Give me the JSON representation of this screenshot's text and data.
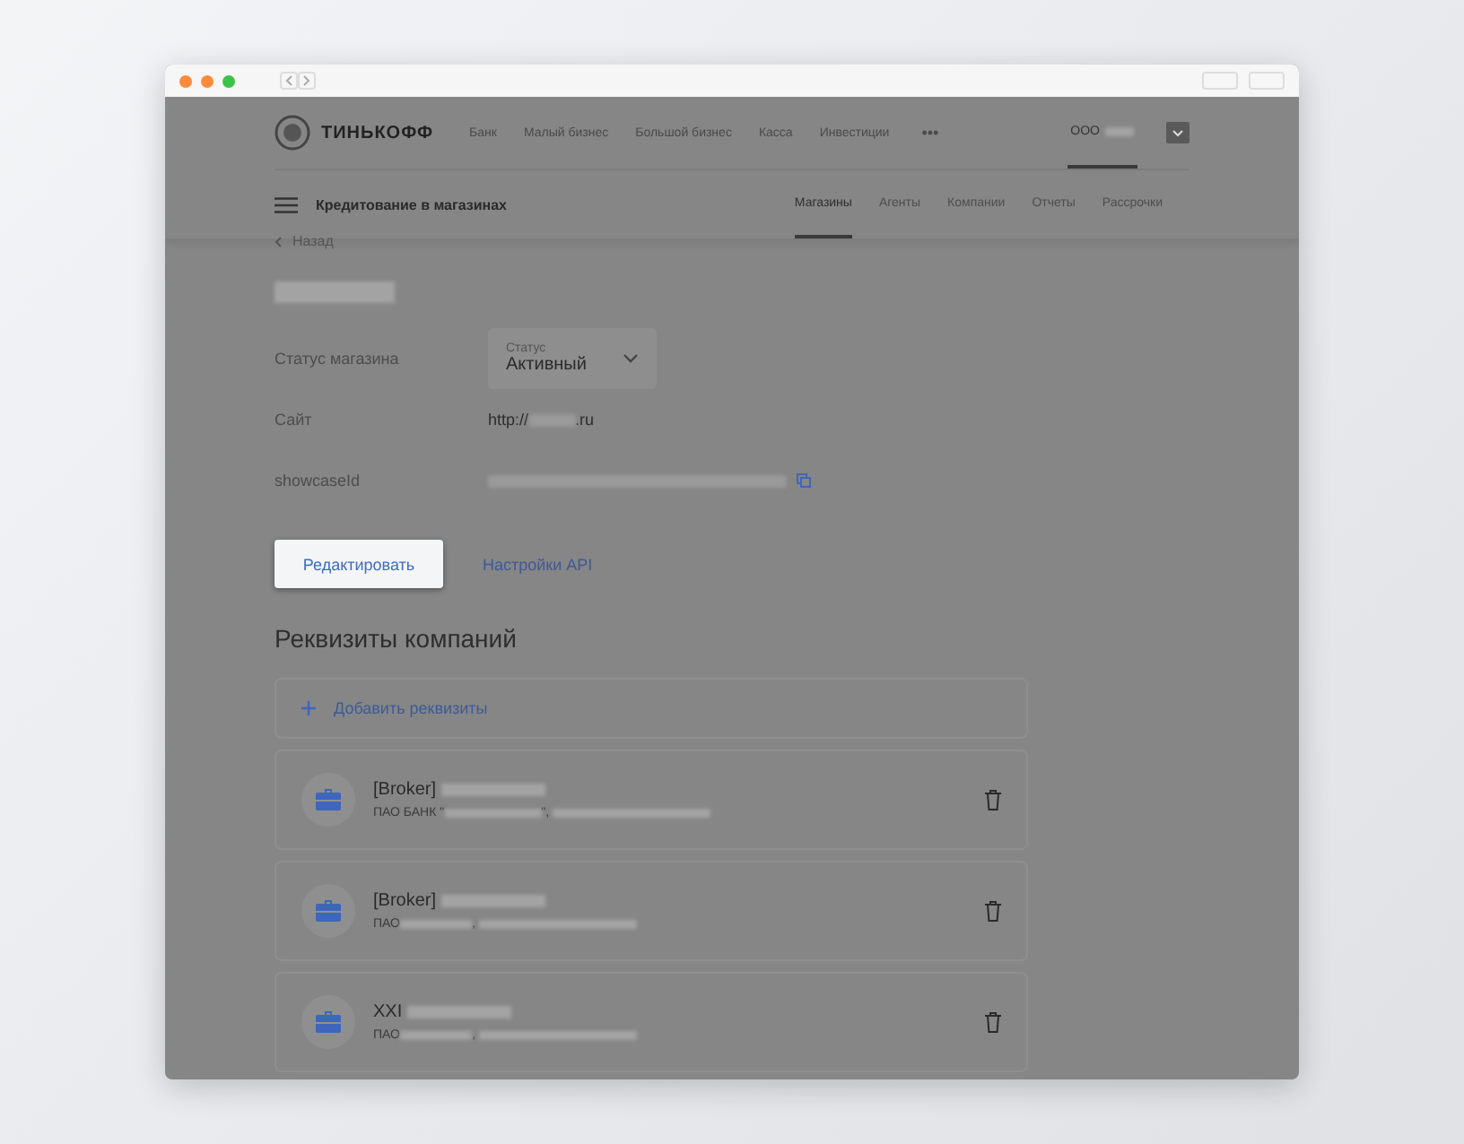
{
  "header": {
    "logo": "ТИНЬКОФФ",
    "nav": [
      "Банк",
      "Малый бизнес",
      "Большой бизнес",
      "Касса",
      "Инвестиции"
    ],
    "more": "•••",
    "account": "ООО"
  },
  "subheader": {
    "title": "Кредитование в магазинах",
    "tabs": [
      {
        "label": "Магазины",
        "selected": true
      },
      {
        "label": "Агенты",
        "selected": false
      },
      {
        "label": "Компании",
        "selected": false
      },
      {
        "label": "Отчеты",
        "selected": false
      },
      {
        "label": "Рассрочки",
        "selected": false
      }
    ]
  },
  "back": "Назад",
  "fields": [
    {
      "kind": "select",
      "label": "Статус магазина",
      "caption": "Статус",
      "value": "Активный"
    },
    {
      "kind": "site",
      "label": "Сайт",
      "prefix": "http://",
      "suffix": ".ru"
    },
    {
      "kind": "id",
      "label": "showcaseId"
    }
  ],
  "buttons": {
    "edit": "Редактировать",
    "api": "Настройки API"
  },
  "section_title": "Реквизиты компаний",
  "add": "Добавить реквизиты",
  "companies": [
    {
      "title": "[Broker]",
      "details": "ПАО БАНК \"",
      "details_after": "\","
    },
    {
      "title": "[Broker]",
      "details": "ПАО",
      "details_after": ","
    },
    {
      "title": "XXI",
      "details": "ПАО",
      "details_after": ","
    }
  ]
}
